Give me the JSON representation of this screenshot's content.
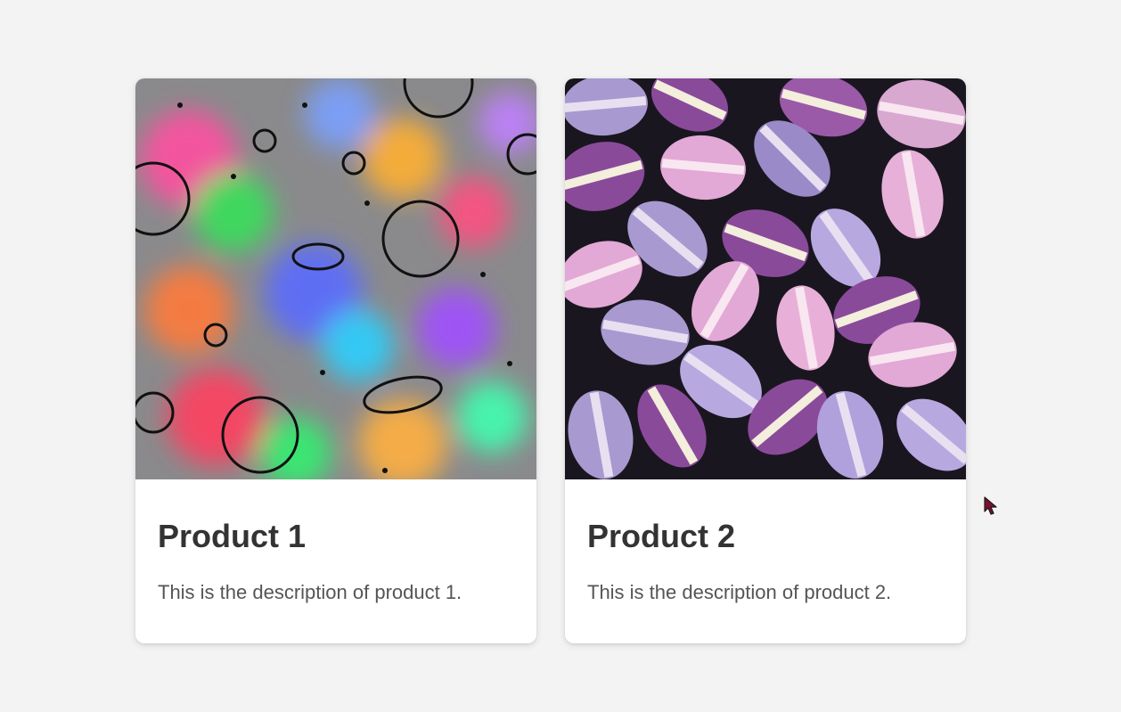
{
  "products": [
    {
      "title": "Product 1",
      "description": "This is the description of product 1.",
      "image": "holographic-space-doodle-image"
    },
    {
      "title": "Product 2",
      "description": "This is the description of product 2.",
      "image": "purple-macarons-image"
    }
  ],
  "colors": {
    "page_background": "#f3f3f3",
    "card_background": "#ffffff",
    "title_text": "#333333",
    "description_text": "#555555",
    "cursor_fill": "#7a1030"
  },
  "cursor": "arrow-cursor-icon"
}
